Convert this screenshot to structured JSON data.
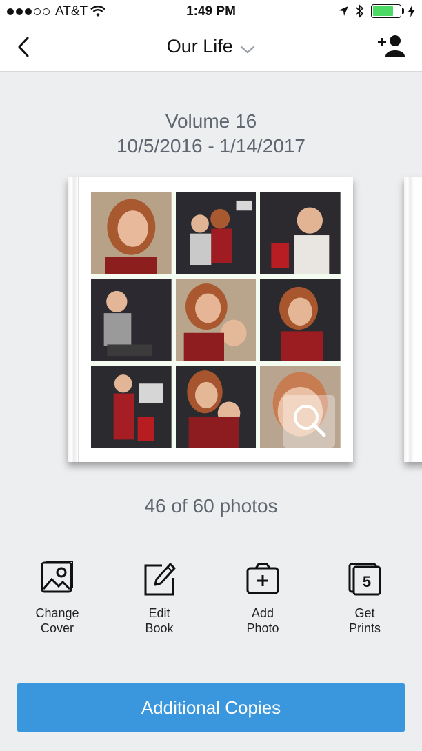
{
  "status": {
    "carrier": "AT&T",
    "time": "1:49 PM",
    "battery_percent": 75,
    "signal_bars_filled": 3,
    "signal_bars_total": 5
  },
  "nav": {
    "title": "Our Life"
  },
  "book": {
    "volume": "Volume 16",
    "dates": "10/5/2016 - 1/14/2017",
    "photo_count": "46 of 60 photos"
  },
  "actions": [
    {
      "label": "Change\nCover",
      "icon": "image-icon"
    },
    {
      "label": "Edit\nBook",
      "icon": "edit-icon"
    },
    {
      "label": "Add\nPhoto",
      "icon": "add-photo-icon"
    },
    {
      "label": "Get\nPrints",
      "icon": "prints-icon",
      "badge": "5"
    }
  ],
  "cta": {
    "label": "Additional Copies"
  },
  "colors": {
    "accent": "#3a97dd",
    "background": "#eceef0",
    "battery": "#4cd964"
  }
}
